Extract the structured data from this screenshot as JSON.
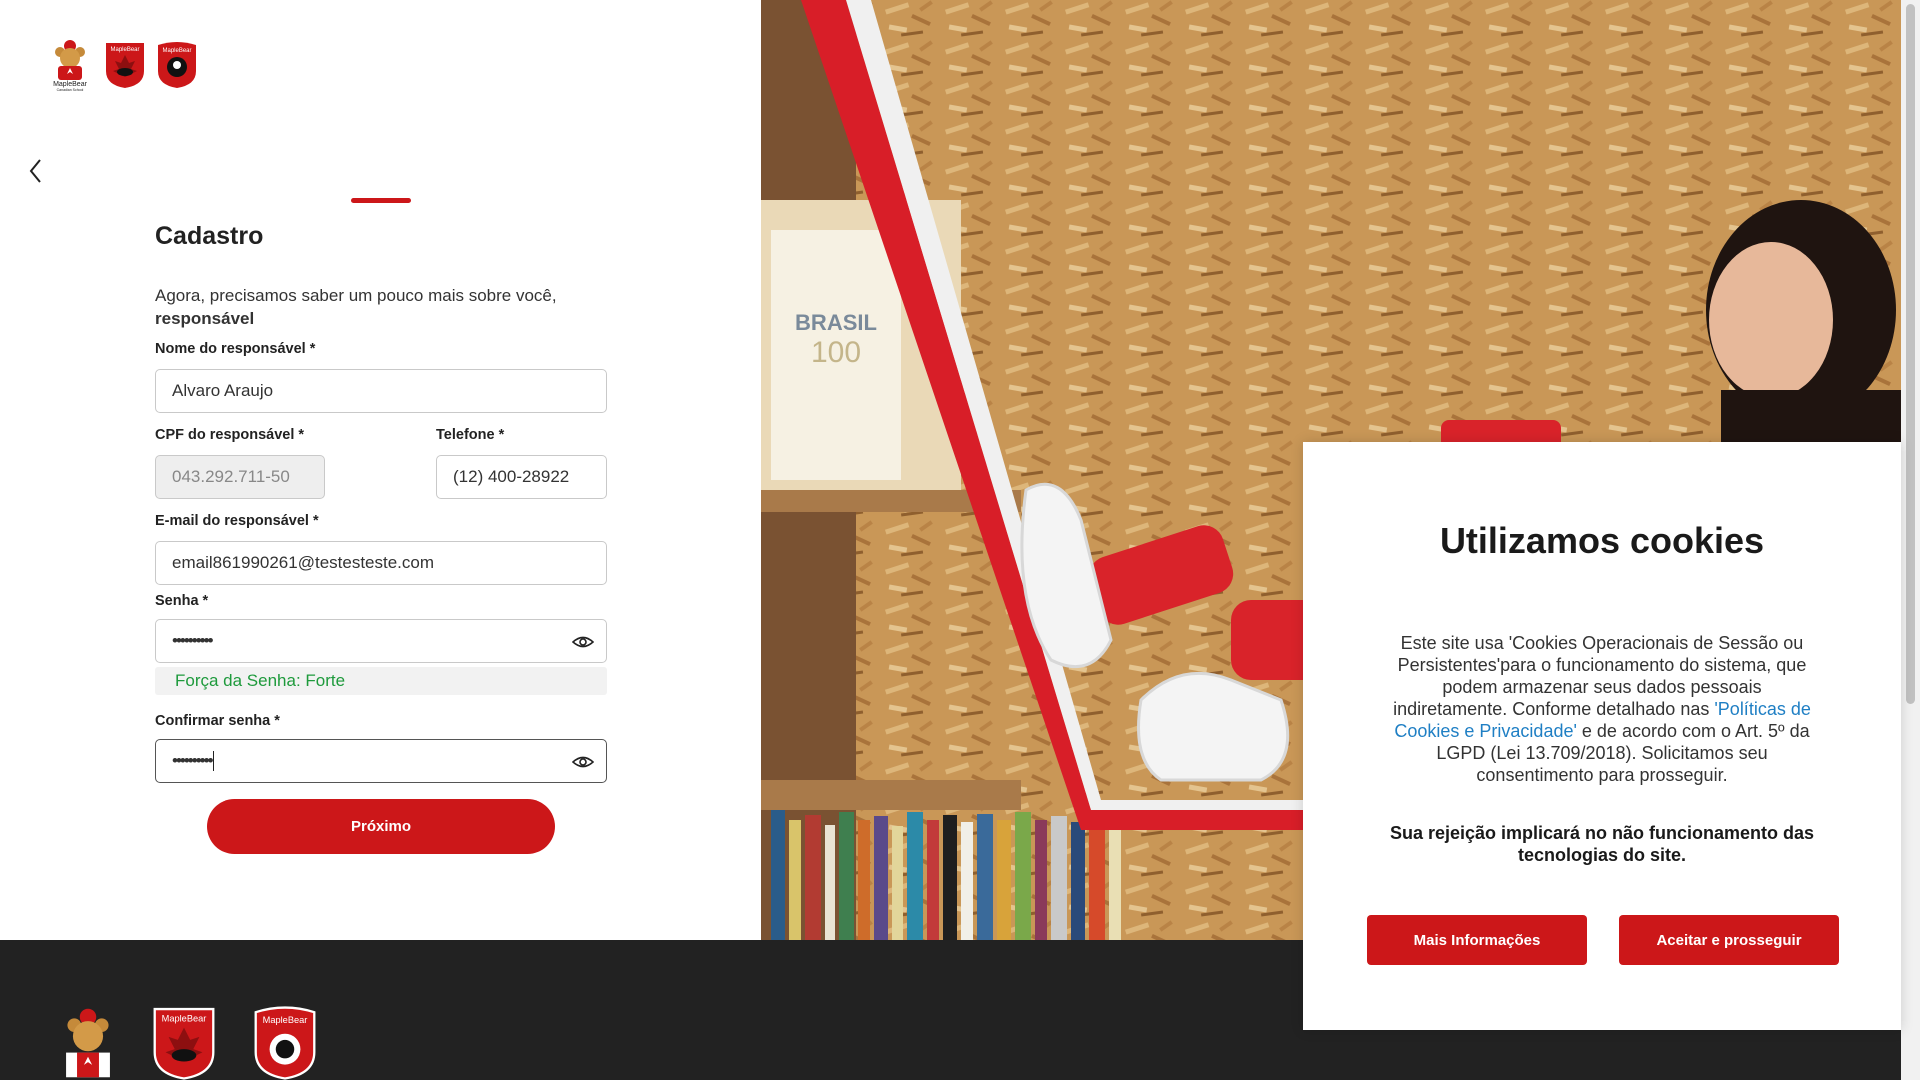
{
  "colors": {
    "accent": "#cc1719",
    "link": "#1f7fc4",
    "success": "#1e9a3c",
    "footer_bg": "#222222"
  },
  "header": {
    "logos": [
      "maple-bear-canadian-school-logo",
      "maple-bear-middle-year-logo",
      "maple-bear-high-school-logo"
    ],
    "logo_caption_1": "MapleBear",
    "logo_caption_1_sub": "Canadian School",
    "logo_shield_text": "MapleBear"
  },
  "form": {
    "title": "Cadastro",
    "intro": "Agora, precisamos saber um pouco mais sobre você,",
    "intro_bold": "responsável",
    "progress": {
      "step_indicator": "active"
    },
    "nome": {
      "label": "Nome do responsável *",
      "value": "Alvaro Araujo"
    },
    "cpf": {
      "label": "CPF do responsável *",
      "value": "043.292.711-50"
    },
    "telefone": {
      "label": "Telefone *",
      "value": "(12) 400-28922"
    },
    "email": {
      "label": "E-mail do responsável *",
      "value": "email861990261@testesteste.com"
    },
    "senha": {
      "label": "Senha *",
      "value": "••••••••••"
    },
    "strength": "Força da Senha: Forte",
    "confirmar": {
      "label": "Confirmar senha *",
      "value": "••••••••••"
    },
    "next_button": "Próximo"
  },
  "cookie": {
    "title": "Utilizamos cookies",
    "text_part1": "Este site usa 'Cookies Operacionais de Sessão ou Persistentes'para o funcionamento do sistema, que podem armazenar seus dados pessoais indiretamente. Conforme detalhado nas",
    "link": "'Políticas de Cookies e Privacidade'",
    "text_part2": " e de acordo com o Art. 5º da LGPD (Lei 13.709/2018). Solicitamos seu consentimento para prosseguir.",
    "warning": "Sua rejeição implicará no não funcionamento das tecnologias do site.",
    "btn_more": "Mais Informações",
    "btn_accept": "Aceitar e prosseguir"
  },
  "photo": {
    "book_title": "BRASIL",
    "book_number": "100"
  }
}
